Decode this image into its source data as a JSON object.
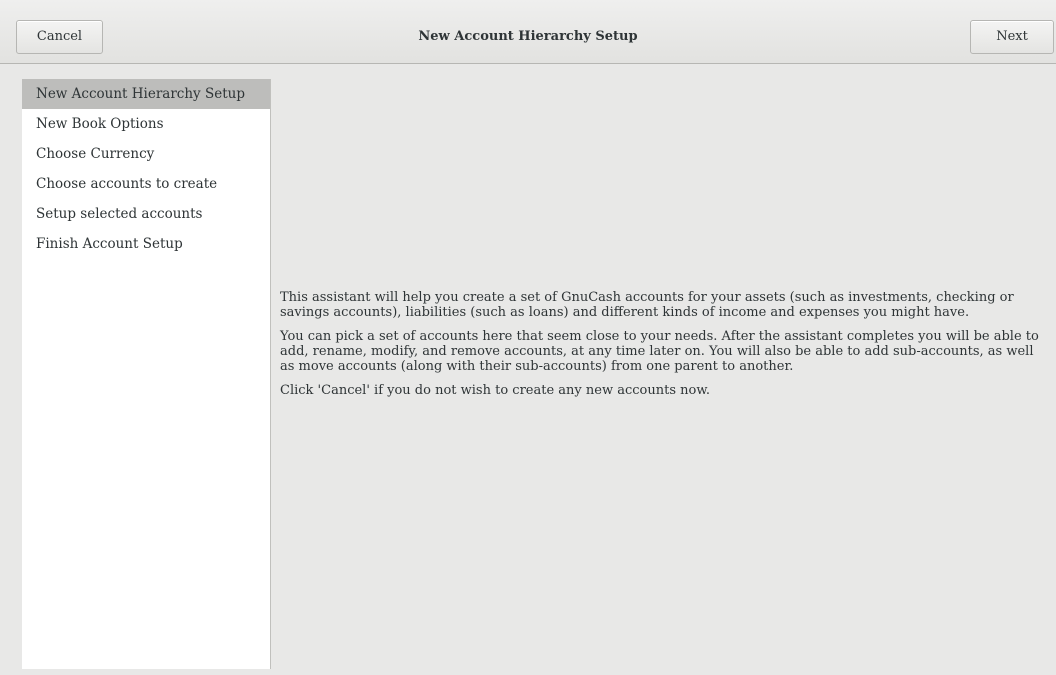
{
  "header": {
    "title": "New Account Hierarchy Setup",
    "cancel_label": "Cancel",
    "next_label": "Next"
  },
  "sidebar": {
    "items": [
      {
        "label": "New Account Hierarchy Setup",
        "active": true
      },
      {
        "label": "New Book Options",
        "active": false
      },
      {
        "label": "Choose Currency",
        "active": false
      },
      {
        "label": "Choose accounts to create",
        "active": false
      },
      {
        "label": "Setup selected accounts",
        "active": false
      },
      {
        "label": "Finish Account Setup",
        "active": false
      }
    ]
  },
  "main": {
    "paragraphs": [
      "This assistant will help you create a set of GnuCash accounts for your assets (such as investments, checking or savings accounts), liabilities (such as loans) and different kinds of income and expenses you might have.",
      "You can pick a set of accounts here that seem close to your needs. After the assistant completes you will be able to add, rename, modify, and remove accounts, at any time later on. You will also be able to add sub-accounts, as well as move accounts (along with their sub-accounts) from one parent to another.",
      "Click 'Cancel'  if you do not wish to create any new accounts now."
    ]
  },
  "colors": {
    "window_bg": "#e8e8e7",
    "sidebar_bg": "#ffffff",
    "active_item_bg": "#bdbdbb"
  }
}
